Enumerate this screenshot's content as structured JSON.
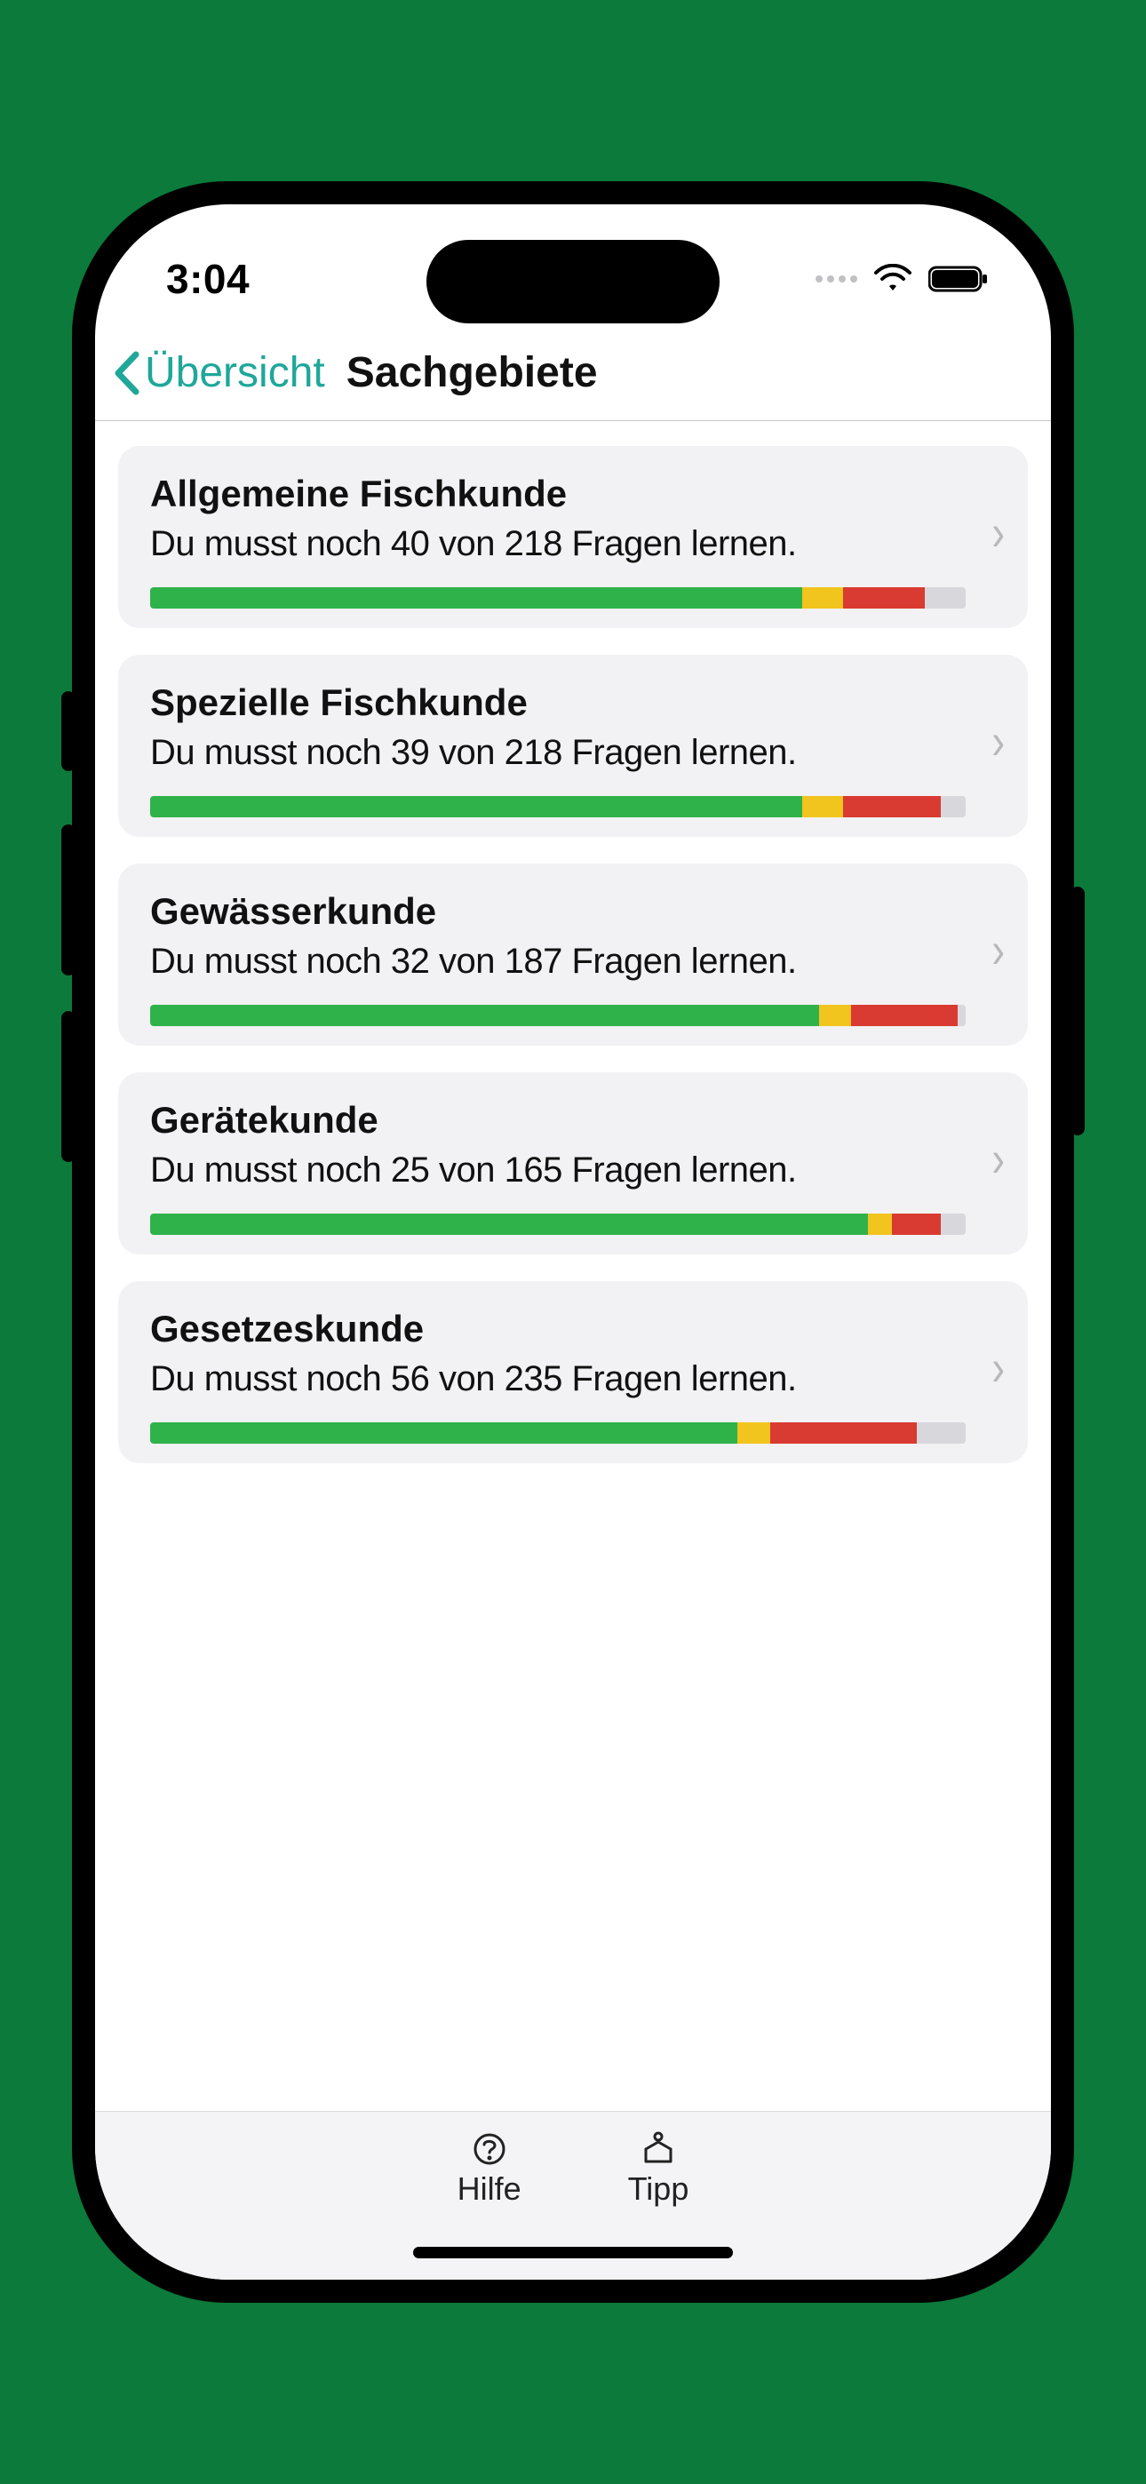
{
  "statusbar": {
    "time": "3:04"
  },
  "nav": {
    "back_label": "Übersicht",
    "title": "Sachgebiete"
  },
  "cards": [
    {
      "title": "Allgemeine Fischkunde",
      "sub": "Du musst noch 40 von 218 Fragen lernen.",
      "remaining": 40,
      "total": 218,
      "segments": {
        "green": 80,
        "yellow": 5,
        "red": 10,
        "grey": 5
      }
    },
    {
      "title": "Spezielle Fischkunde",
      "sub": "Du musst noch 39 von 218 Fragen lernen.",
      "remaining": 39,
      "total": 218,
      "segments": {
        "green": 80,
        "yellow": 5,
        "red": 12,
        "grey": 3
      }
    },
    {
      "title": "Gewässerkunde",
      "sub": "Du musst noch 32 von 187 Fragen lernen.",
      "remaining": 32,
      "total": 187,
      "segments": {
        "green": 82,
        "yellow": 4,
        "red": 13,
        "grey": 1
      }
    },
    {
      "title": "Gerätekunde",
      "sub": "Du musst noch 25 von 165 Fragen lernen.",
      "remaining": 25,
      "total": 165,
      "segments": {
        "green": 88,
        "yellow": 3,
        "red": 6,
        "grey": 3
      }
    },
    {
      "title": "Gesetzeskunde",
      "sub": "Du musst noch 56 von 235 Fragen lernen.",
      "remaining": 56,
      "total": 235,
      "segments": {
        "green": 72,
        "yellow": 4,
        "red": 18,
        "grey": 6
      }
    }
  ],
  "toolbar": {
    "help_label": "Hilfe",
    "tip_label": "Tipp"
  }
}
